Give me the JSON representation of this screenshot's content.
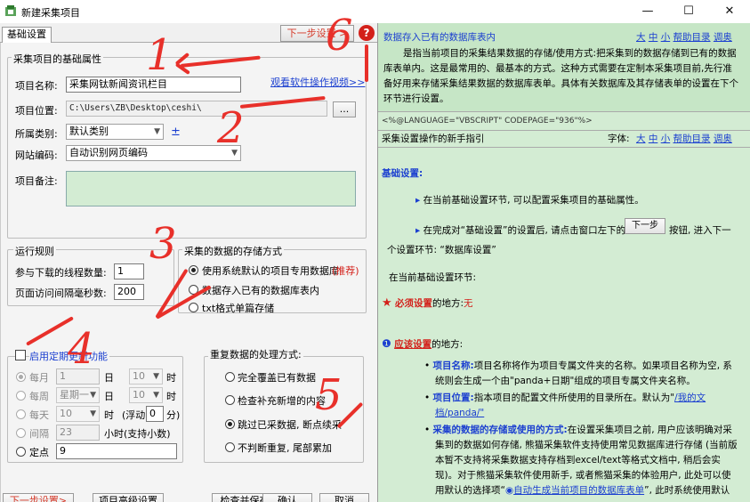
{
  "window": {
    "title": "新建采集项目",
    "minimize": "—",
    "maximize": "☐",
    "close": "✕"
  },
  "tabs": {
    "basic": "基础设置"
  },
  "toolbar": {
    "next_top": "下一步设置 >"
  },
  "basic_group": {
    "title": "采集项目的基础属性",
    "name_label": "项目名称:",
    "name_value": "采集网钛新闻资讯栏目",
    "video_link": "观看软件操作视频>>",
    "location_label": "项目位置:",
    "location_value": "C:\\Users\\ZB\\Desktop\\ceshi\\",
    "browse_button": "...",
    "category_label": "所属类别:",
    "category_value": "默认类别",
    "category_add": "±",
    "encoding_label": "网站编码:",
    "encoding_value": "自动识别网页编码",
    "notes_label": "项目备注:",
    "notes_value": ""
  },
  "run_group": {
    "title": "运行规则",
    "threads_label": "参与下载的线程数量:",
    "threads_value": "1",
    "interval_label": "页面访问间隔毫秒数:",
    "interval_value": "200"
  },
  "storage_group": {
    "title": "采集的数据的存储方式",
    "options": [
      {
        "label": "使用系统默认的项目专用数据库",
        "selected": true
      },
      {
        "label": "数据存入已有的数据库表内",
        "selected": false
      },
      {
        "label": "txt格式单篇存储",
        "selected": false
      }
    ],
    "recommend": "(推荐)"
  },
  "schedule_group": {
    "enable_label": "启用定期更新功能",
    "monthly": {
      "label": "每月",
      "value1": "1",
      "unit1": "日",
      "value2": "10",
      "unit2": "时"
    },
    "weekly": {
      "label": "每周",
      "value1": "星期一",
      "unit1": "日",
      "value2": "10",
      "unit2": "时"
    },
    "daily": {
      "label": "每天",
      "value1": "10",
      "unit1": "时",
      "float_label": "(浮动",
      "float_value": "0",
      "float_unit": "分)"
    },
    "interval": {
      "label": "间隔",
      "value": "23",
      "unit": "小时(支持小数)"
    },
    "fixed": {
      "label": "定点",
      "value": "9"
    }
  },
  "duplicate_group": {
    "title": "重复数据的处理方式:",
    "options": [
      {
        "label": "完全覆盖已有数据",
        "selected": false
      },
      {
        "label": "检查补充新增的内容",
        "selected": false
      },
      {
        "label": "跳过已采数据, 断点续采",
        "selected": true
      },
      {
        "label": "不判断重复, 尾部累加",
        "selected": false
      }
    ]
  },
  "bottom_buttons": [
    "下一步设置>",
    "项目高级设置",
    "检查并保存",
    "确认",
    "取消"
  ],
  "annotations": [
    "1",
    "2",
    "3",
    "4",
    "5",
    "6"
  ],
  "help_icon": "?",
  "help_top": {
    "title": "数据存入已有的数据库表内",
    "links": [
      "大",
      "中",
      "小",
      "帮助目录",
      "调奥"
    ],
    "lines": [
      "是指当前项目的采集结果数据的存储/使用方式:把采集到的数据存储到已有的数据",
      "库表单内。这是最常用的、最基本的方式。这种方式需要在定制本采集项目前,先行准",
      "备好用来存储采集结果数据的数据库表单。具体有关数据库及其存储表单的设置在下个",
      "环节进行设置。"
    ]
  },
  "code_line": "<%@LANGUAGE=\"VBSCRIPT\" CODEPAGE=\"936\"%>",
  "help_guide": {
    "title": "采集设置操作的新手指引",
    "font_label": "字体:",
    "links": [
      "大",
      "中",
      "小",
      "帮助目录",
      "调奥"
    ],
    "section_basic": "基础设置:",
    "p1": "在当前基础设置环节, 可以配置采集项目的基础属性。",
    "p2a": "在完成对“基础设置”的设置后, 请点击窗口左下的",
    "p2_button": "下一步",
    "p2b": "按钮, 进入下一",
    "p2c": "个设置环节: “数据库设置”",
    "p3": "在当前基础设置环节:",
    "must_a": "必须设置",
    "must_b": "的地方:",
    "must_c": "无",
    "should_a": "应该设置",
    "should_b": "的地方:",
    "b1_title": "项目名称:",
    "b1_a": "项目名称将作为项目专属文件夹的名称。如果项目名称为空, 系",
    "b1_b": "统则会生成一个由\"panda+日期\"组成的项目专属文件夹名称。",
    "b2_title": "项目位置:",
    "b2_a": "指本项目的配置文件所使用的目录所在。默认为\"",
    "b2_link": "/我的文",
    "b2_b": "档/panda/\"",
    "b3_title": "采集的数据的存储或使用的方式:",
    "b3_a": "在设置采集项目之前, 用户应该明确对采",
    "b3_b": "集到的数据如何存储, 熊猫采集软件支持使用常见数据库进行存储 (当前版",
    "b3_c": "本暂不支持将采集数据支持存档到excel/text等格式文档中, 稍后会实",
    "b3_d": "现)。对于熊猫采集软件使用新手, 或者熊猫采集的体验用户, 此处可以使",
    "b3_e": "用默认的选择项“",
    "b3_f": "自动生成当前项目的数据库表单",
    "b3_g": "”, 此时系统使用默认"
  }
}
